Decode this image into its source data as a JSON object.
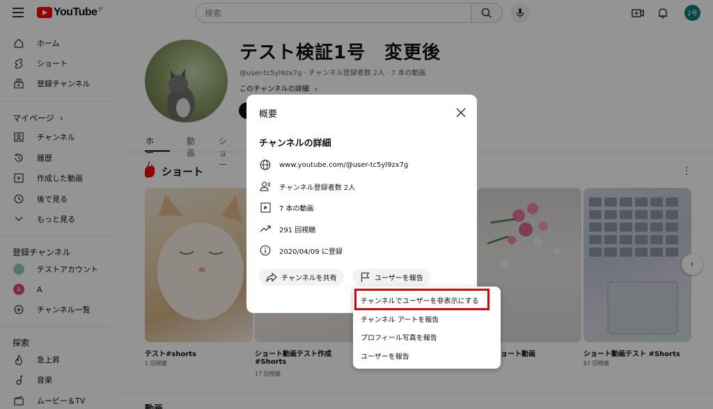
{
  "header": {
    "logo_text": "YouTube",
    "logo_region": "JP",
    "search_placeholder": "検索",
    "avatar_label": "2号"
  },
  "sidebar": {
    "main_items": [
      {
        "label": "ホーム",
        "icon": "home-icon"
      },
      {
        "label": "ショート",
        "icon": "shorts-icon"
      },
      {
        "label": "登録チャンネル",
        "icon": "subscriptions-icon"
      }
    ],
    "mypage_title": "マイページ",
    "mypage_items": [
      {
        "label": "チャンネル",
        "icon": "channel-icon"
      },
      {
        "label": "履歴",
        "icon": "history-icon"
      },
      {
        "label": "作成した動画",
        "icon": "your-videos-icon"
      },
      {
        "label": "後で見る",
        "icon": "watch-later-icon"
      },
      {
        "label": "もっと見る",
        "icon": "chevron-down-icon"
      }
    ],
    "subs_title": "登録チャンネル",
    "subs_items": [
      {
        "label": "テストアカウント",
        "avatar_color": "#8ecfc0"
      },
      {
        "label": "A",
        "avatar_letter": "A",
        "avatar_color": "#e0457b"
      },
      {
        "label": "チャンネル一覧",
        "icon": "add-circle-icon"
      }
    ],
    "explore_title": "探索",
    "explore_items": [
      {
        "label": "急上昇",
        "icon": "trending-icon"
      },
      {
        "label": "音楽",
        "icon": "music-icon"
      },
      {
        "label": "ムービー＆TV",
        "icon": "movies-icon"
      }
    ]
  },
  "channel": {
    "title": "テスト検証1号　変更後",
    "meta": "@user-tc5yl9zx7g · チャンネル登録者数 2人 · 7 本の動画",
    "details_link": "このチャンネルの詳細",
    "tabs": [
      "ホーム",
      "動画",
      "ショー"
    ]
  },
  "shorts": {
    "section_title": "ショート",
    "items": [
      {
        "title": "テスト#shorts",
        "views": "1 回視聴"
      },
      {
        "title": "ショート動画テスト作成 #Shorts",
        "title_line1": "ショート動画テスト作成",
        "title_line2": "#Shorts",
        "views": "17 回視聴"
      },
      {
        "title": "ョート動画",
        "views": ""
      },
      {
        "title": "ショート動画テスト #Shorts",
        "views": "87 回視聴"
      }
    ]
  },
  "videos_title": "動画",
  "modal": {
    "title": "概要",
    "subtitle": "チャンネルの詳細",
    "details": [
      {
        "icon": "globe-icon",
        "text": "www.youtube.com/@user-tc5yl9zx7g"
      },
      {
        "icon": "subscribers-icon",
        "text": "チャンネル登録者数 2人"
      },
      {
        "icon": "video-icon",
        "text": "7 本の動画"
      },
      {
        "icon": "trending-icon",
        "text": "291 回視聴"
      },
      {
        "icon": "info-icon",
        "text": "2020/04/09 に登録"
      }
    ],
    "share_label": "チャンネルを共有",
    "report_label": "ユーザーを報告"
  },
  "dropdown": {
    "items": [
      "チャンネルでユーザーを非表示にする",
      "チャンネル アートを報告",
      "プロフィール写真を報告",
      "ユーザーを報告"
    ],
    "highlight_color": "#e00000"
  }
}
